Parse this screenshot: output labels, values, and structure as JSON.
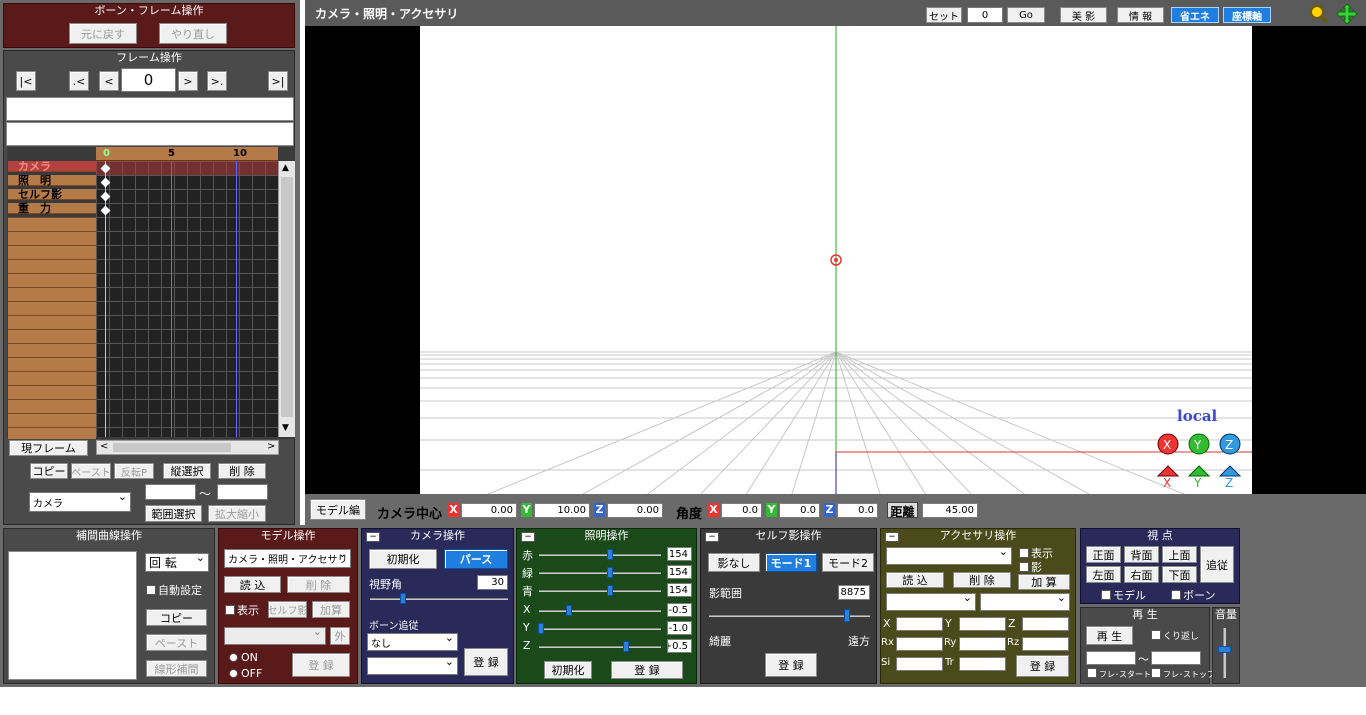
{
  "bone_frame": {
    "title": "ボーン・フレーム操作",
    "undo": "元に戻す",
    "redo": "やり直し"
  },
  "frame_op": {
    "title": "フレーム操作",
    "first": "|<",
    "prev_key": ".<",
    "prev": "<",
    "frame": "0",
    "next": ">",
    "next_key": ">.",
    "last": ">|"
  },
  "timeline": {
    "ticks": [
      "0",
      "5",
      "10"
    ],
    "rows": [
      "カメラ",
      "照　明",
      "セルフ影",
      "重　力"
    ],
    "current_frame": "現フレーム"
  },
  "edit": {
    "copy": "コピー",
    "paste": "ペースト",
    "flip": "反転P",
    "vsel": "縦選択",
    "del": "削 除",
    "model_select": "カメラ",
    "range": "範囲選択",
    "scale": "拡大縮小",
    "tilde": "〜"
  },
  "viewport": {
    "title": "カメラ・照明・アクセサリ",
    "set": "セット",
    "set_value": "0",
    "go": "Go",
    "beauty": "美 影",
    "info": "情 報",
    "eco": "省エネ",
    "axis": "座標軸",
    "local": "local"
  },
  "camera_bar": {
    "model_edit": "モデル編",
    "center": "カメラ中心",
    "x": "0.00",
    "y": "10.00",
    "z": "0.00",
    "angle": "角度",
    "ax": "0.0",
    "ay": "0.0",
    "az": "0.0",
    "dist_label": "距離",
    "dist": "45.00",
    "lx": "X",
    "ly": "Y",
    "lz": "Z"
  },
  "interp": {
    "title": "補間曲線操作",
    "rotate": "回 転",
    "auto": "自動設定",
    "copy": "コピー",
    "paste": "ペースト",
    "linear": "線形補間"
  },
  "model": {
    "title": "モデル操作",
    "select": "カメラ・照明・アクセサリ",
    "load": "読 込",
    "del": "削 除",
    "show": "表示",
    "self_shadow": "セルフ影",
    "add": "加算",
    "outside": "外",
    "on": "ON",
    "off": "OFF",
    "reg": "登 録"
  },
  "camera": {
    "title": "カメラ操作",
    "init": "初期化",
    "perspective": "パース",
    "fov_label": "視野角",
    "fov": "30",
    "bone_follow": "ボーン追従",
    "none": "なし",
    "reg": "登 録"
  },
  "light": {
    "title": "照明操作",
    "r_label": "赤",
    "g_label": "緑",
    "b_label": "青",
    "r": "154",
    "g": "154",
    "b": "154",
    "x_label": "X",
    "y_label": "Y",
    "z_label": "Z",
    "x": "-0.5",
    "y": "-1.0",
    "z": "+0.5",
    "init": "初期化",
    "reg": "登 録"
  },
  "shadow": {
    "title": "セルフ影操作",
    "none": "影なし",
    "mode1": "モード1",
    "mode2": "モード2",
    "range_label": "影範囲",
    "range": "8875",
    "near": "綺麗",
    "far": "遠方",
    "reg": "登 録"
  },
  "accessory": {
    "title": "アクセサリ操作",
    "show": "表示",
    "shadow": "影",
    "load": "読 込",
    "del": "削 除",
    "add": "加 算",
    "x": "X",
    "y": "Y",
    "z": "Z",
    "rx": "Rx",
    "ry": "Ry",
    "rz": "Rz",
    "si": "Si",
    "tr": "Tr",
    "reg": "登 録"
  },
  "view": {
    "title": "視 点",
    "front": "正面",
    "back": "背面",
    "top": "上面",
    "follow": "追従",
    "left": "左面",
    "right": "右面",
    "bottom": "下面",
    "model": "モデル",
    "bone": "ボーン"
  },
  "play": {
    "title": "再 生",
    "play": "再 生",
    "loop": "くり返し",
    "tilde": "〜",
    "start": "フレ･スタート",
    "stop": "フレ･ストップ"
  },
  "volume": {
    "title": "音量"
  }
}
